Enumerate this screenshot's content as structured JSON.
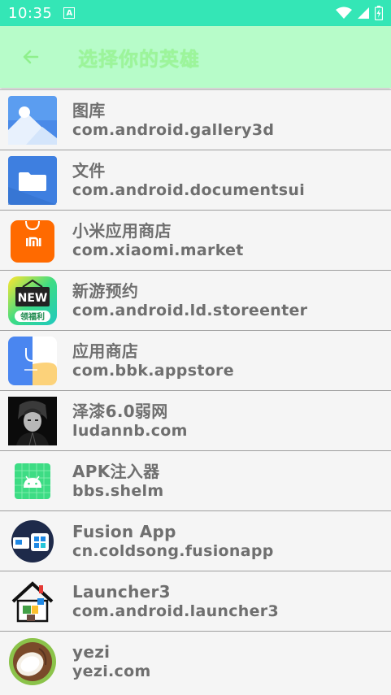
{
  "status_bar": {
    "time": "10:35",
    "indicator": "A"
  },
  "toolbar": {
    "title": "选择你的英雄"
  },
  "apps": [
    {
      "name": "图库",
      "package": "com.android.gallery3d",
      "icon": "gallery-icon"
    },
    {
      "name": "文件",
      "package": "com.android.documentsui",
      "icon": "folder-icon"
    },
    {
      "name": "小米应用商店",
      "package": "com.xiaomi.market",
      "icon": "mi-store-icon"
    },
    {
      "name": "新游预约",
      "package": "com.android.ld.storeenter",
      "icon": "new-games-icon",
      "icon_text_top": "NEW",
      "icon_text_bottom": "领福利"
    },
    {
      "name": "应用商店",
      "package": "com.bbk.appstore",
      "icon": "appstore-bag-icon"
    },
    {
      "name": "泽漆6.0弱网",
      "package": "ludannb.com",
      "icon": "dark-portrait-icon"
    },
    {
      "name": "APK注入器",
      "package": "bbs.shelm",
      "icon": "android-robot-icon"
    },
    {
      "name": "Fusion App",
      "package": "cn.coldsong.fusionapp",
      "icon": "fusion-app-icon"
    },
    {
      "name": "Launcher3",
      "package": "com.android.launcher3",
      "icon": "house-icon"
    },
    {
      "name": "yezi",
      "package": "yezi.com",
      "icon": "coconut-icon"
    }
  ],
  "colors": {
    "status_bar": "#34e6b6",
    "toolbar": "#b7fcc9",
    "title": "#9cf59a",
    "text": "#6f6f6f"
  }
}
